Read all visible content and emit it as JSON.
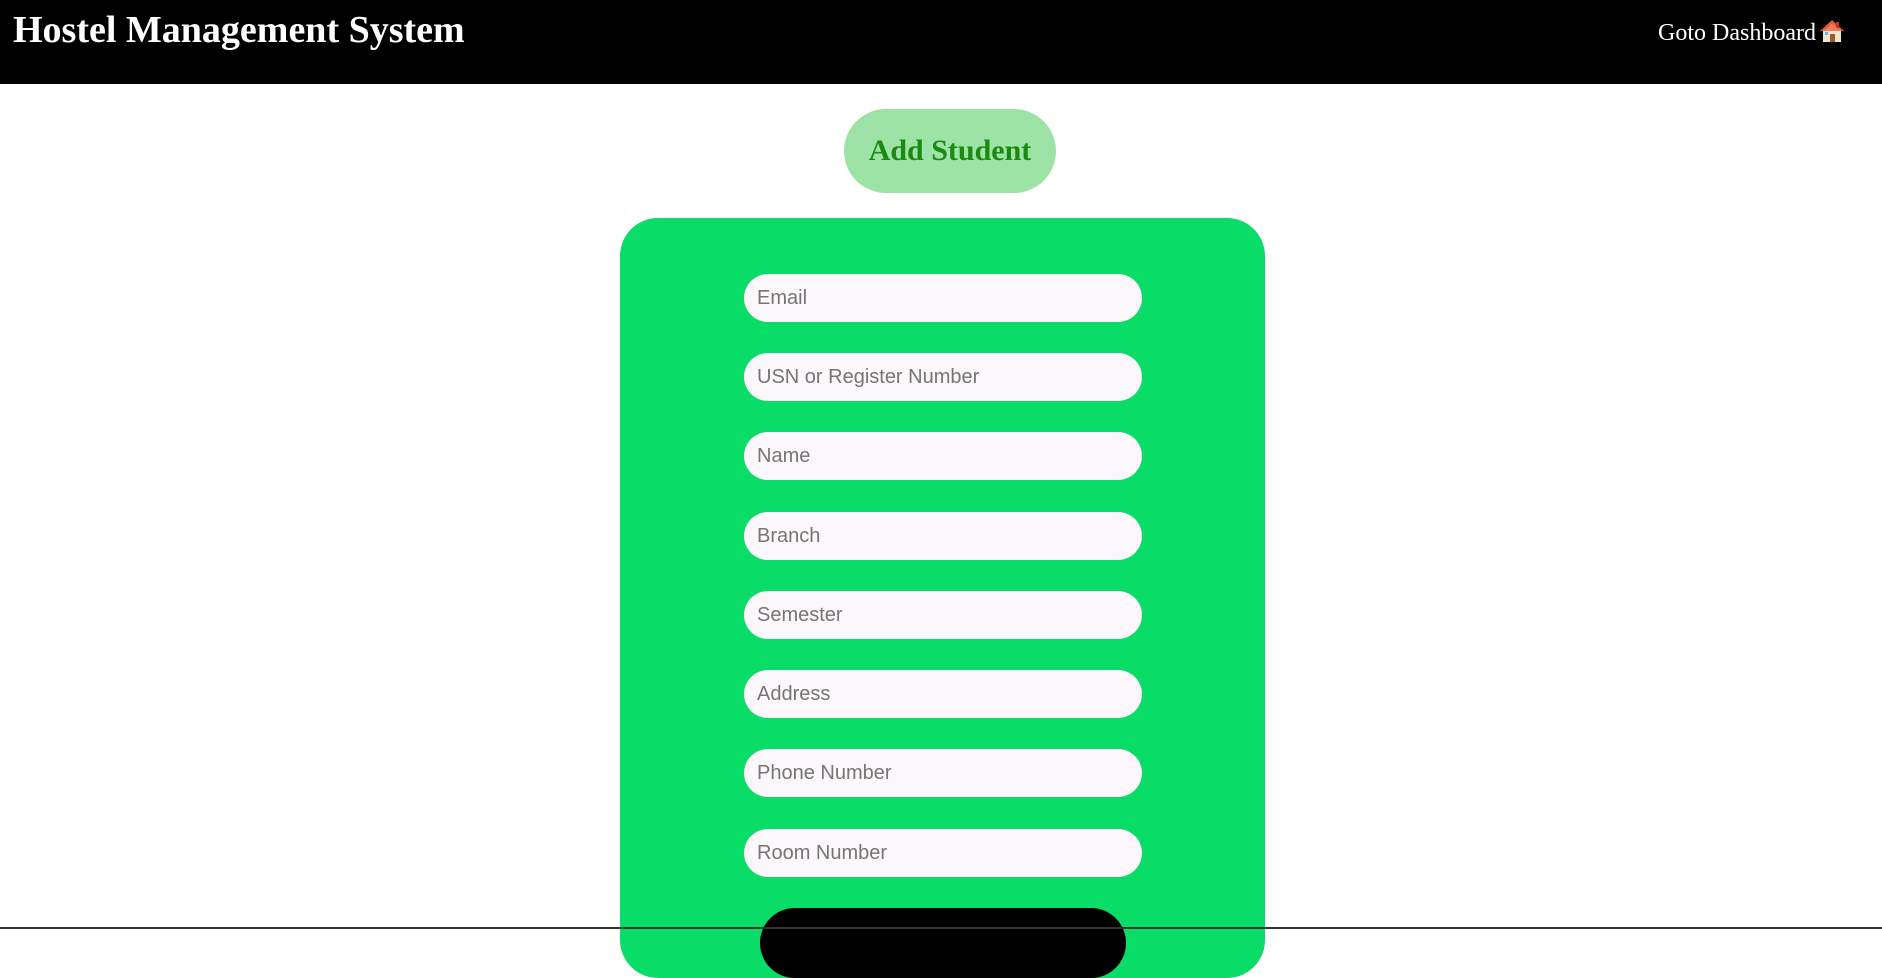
{
  "header": {
    "title": "Hostel Management System",
    "dashboard_link": "Goto Dashboard",
    "dashboard_icon": "house-icon"
  },
  "page": {
    "heading": "Add Student"
  },
  "form": {
    "fields": [
      {
        "placeholder": "Email",
        "value": ""
      },
      {
        "placeholder": "USN or Register Number",
        "value": ""
      },
      {
        "placeholder": "Name",
        "value": ""
      },
      {
        "placeholder": "Branch",
        "value": ""
      },
      {
        "placeholder": "Semester",
        "value": ""
      },
      {
        "placeholder": "Address",
        "value": ""
      },
      {
        "placeholder": "Phone Number",
        "value": ""
      },
      {
        "placeholder": "Room Number",
        "value": ""
      }
    ]
  },
  "colors": {
    "navbar": "#000000",
    "card": "#09dc67",
    "heading_pill": "#9ee3a6",
    "heading_text": "#1c8a12",
    "input_bg": "#fcf7fa"
  }
}
